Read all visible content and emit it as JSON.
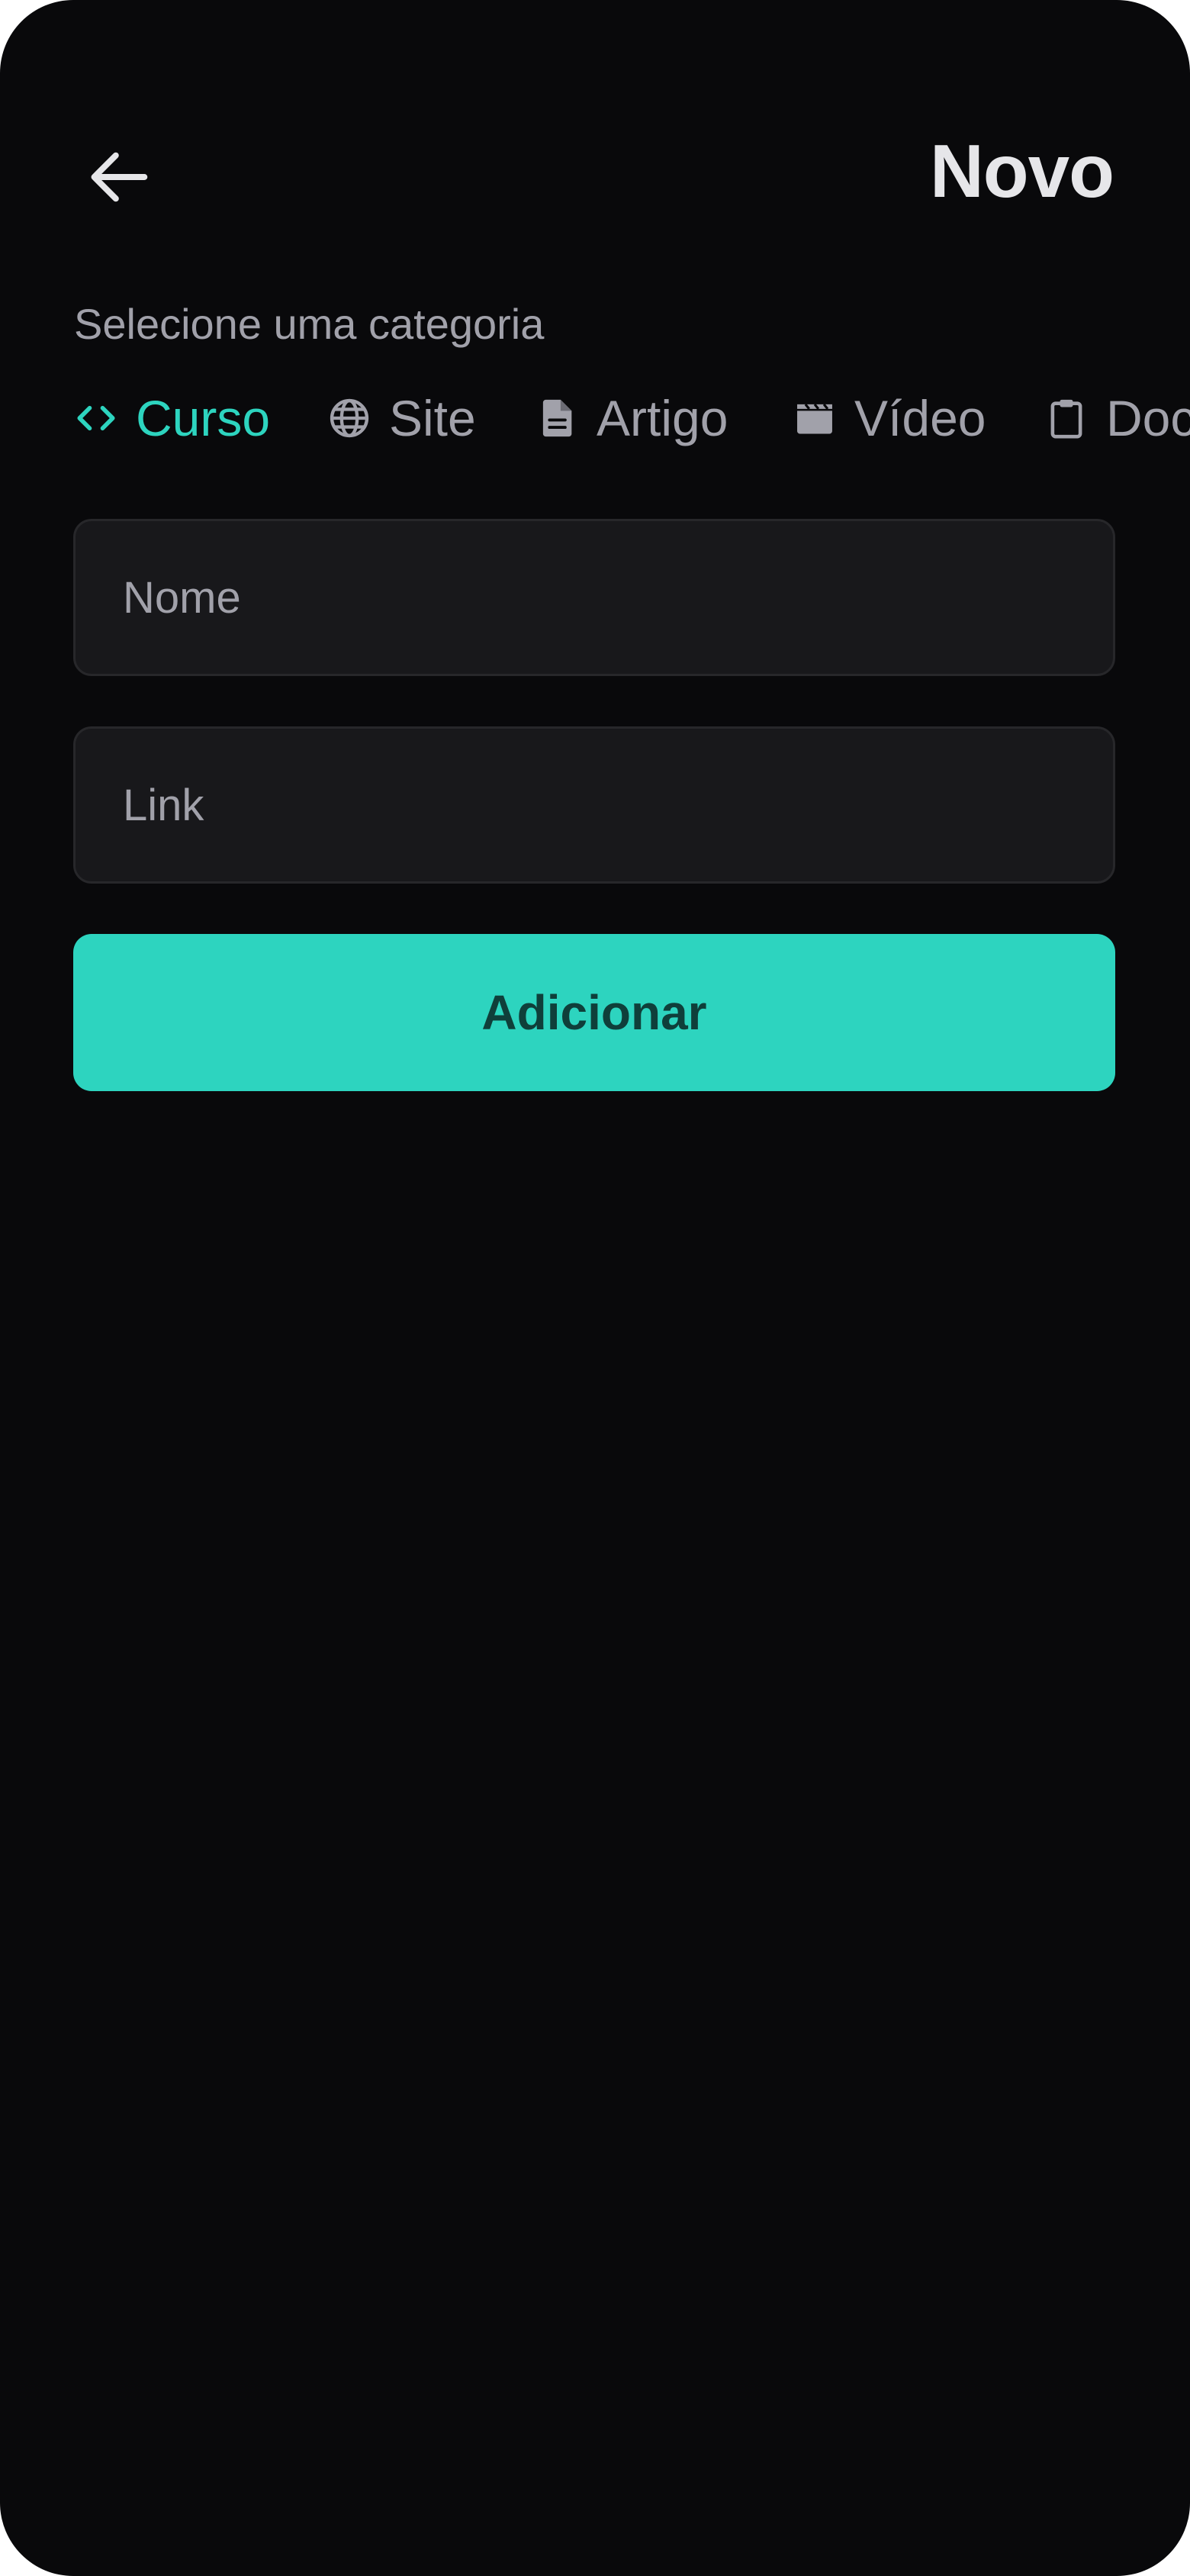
{
  "header": {
    "title": "Novo",
    "back_icon": "arrow-left-icon"
  },
  "category_section": {
    "label": "Selecione uma categoria",
    "selected": "Curso",
    "items": [
      {
        "label": "Curso",
        "icon": "code-icon",
        "active": true
      },
      {
        "label": "Site",
        "icon": "globe-icon",
        "active": false
      },
      {
        "label": "Artigo",
        "icon": "document-icon",
        "active": false
      },
      {
        "label": "Vídeo",
        "icon": "clapperboard-icon",
        "active": false
      },
      {
        "label": "Doc",
        "icon": "clipboard-icon",
        "active": false
      }
    ]
  },
  "form": {
    "name_placeholder": "Nome",
    "name_value": "",
    "link_placeholder": "Link",
    "link_value": "",
    "submit_label": "Adicionar"
  },
  "colors": {
    "background": "#09090b",
    "accent": "#2dd4bf",
    "field_background": "#18181b",
    "field_border": "#27272a",
    "muted_text": "#a1a1aa",
    "title_text": "#e6e6e9",
    "button_text": "#0f3f3a"
  }
}
